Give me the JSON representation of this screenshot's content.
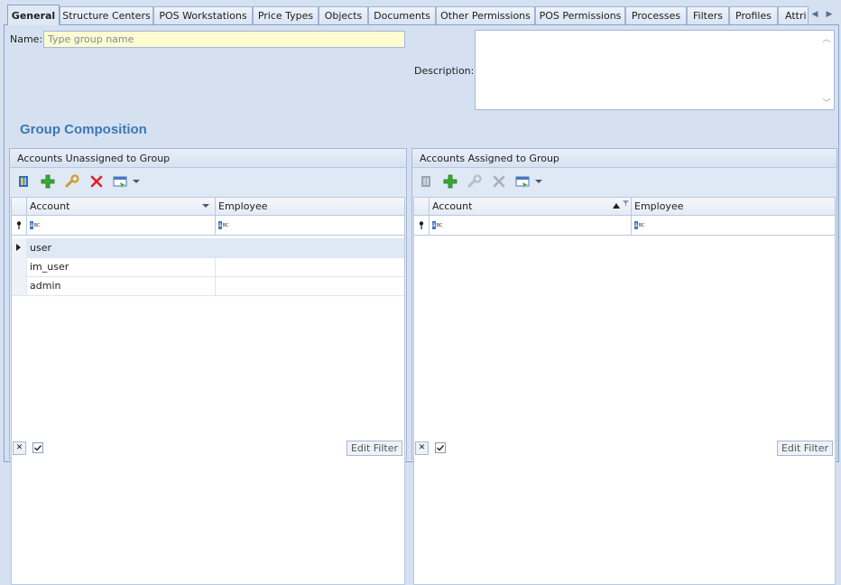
{
  "tabs": [
    {
      "label": "General",
      "active": true
    },
    {
      "label": "Structure Centers"
    },
    {
      "label": "POS Workstations"
    },
    {
      "label": "Price Types"
    },
    {
      "label": "Objects"
    },
    {
      "label": "Documents"
    },
    {
      "label": "Other Permissions"
    },
    {
      "label": "POS Permissions"
    },
    {
      "label": "Processes"
    },
    {
      "label": "Filters"
    },
    {
      "label": "Profiles"
    },
    {
      "label": "Attri"
    }
  ],
  "form": {
    "name_label": "Name:",
    "name_placeholder": "Type group name",
    "name_value": "",
    "description_label": "Description:",
    "description_value": ""
  },
  "group_composition": {
    "title": "Group Composition",
    "unassigned": {
      "header": "Accounts Unassigned to Group",
      "columns": [
        "Account",
        "Employee"
      ],
      "rows": [
        {
          "account": "user",
          "employee": ""
        },
        {
          "account": "im_user",
          "employee": ""
        },
        {
          "account": "admin",
          "employee": ""
        }
      ],
      "edit_filter": "Edit Filter"
    },
    "assigned": {
      "header": "Accounts Assigned to Group",
      "columns": [
        "Account",
        "Employee"
      ],
      "rows": [],
      "edit_filter": "Edit Filter"
    }
  },
  "icons": {
    "link": "link-icon",
    "add": "add-icon",
    "edit": "wrench-icon",
    "delete": "delete-icon",
    "grid_layout": "grid-layout-icon"
  },
  "colors": {
    "accent": "#3c78b8",
    "add": "#39a935",
    "delete": "#e02020",
    "input_highlight": "#fdfbd0"
  },
  "filter_token": "ABC"
}
